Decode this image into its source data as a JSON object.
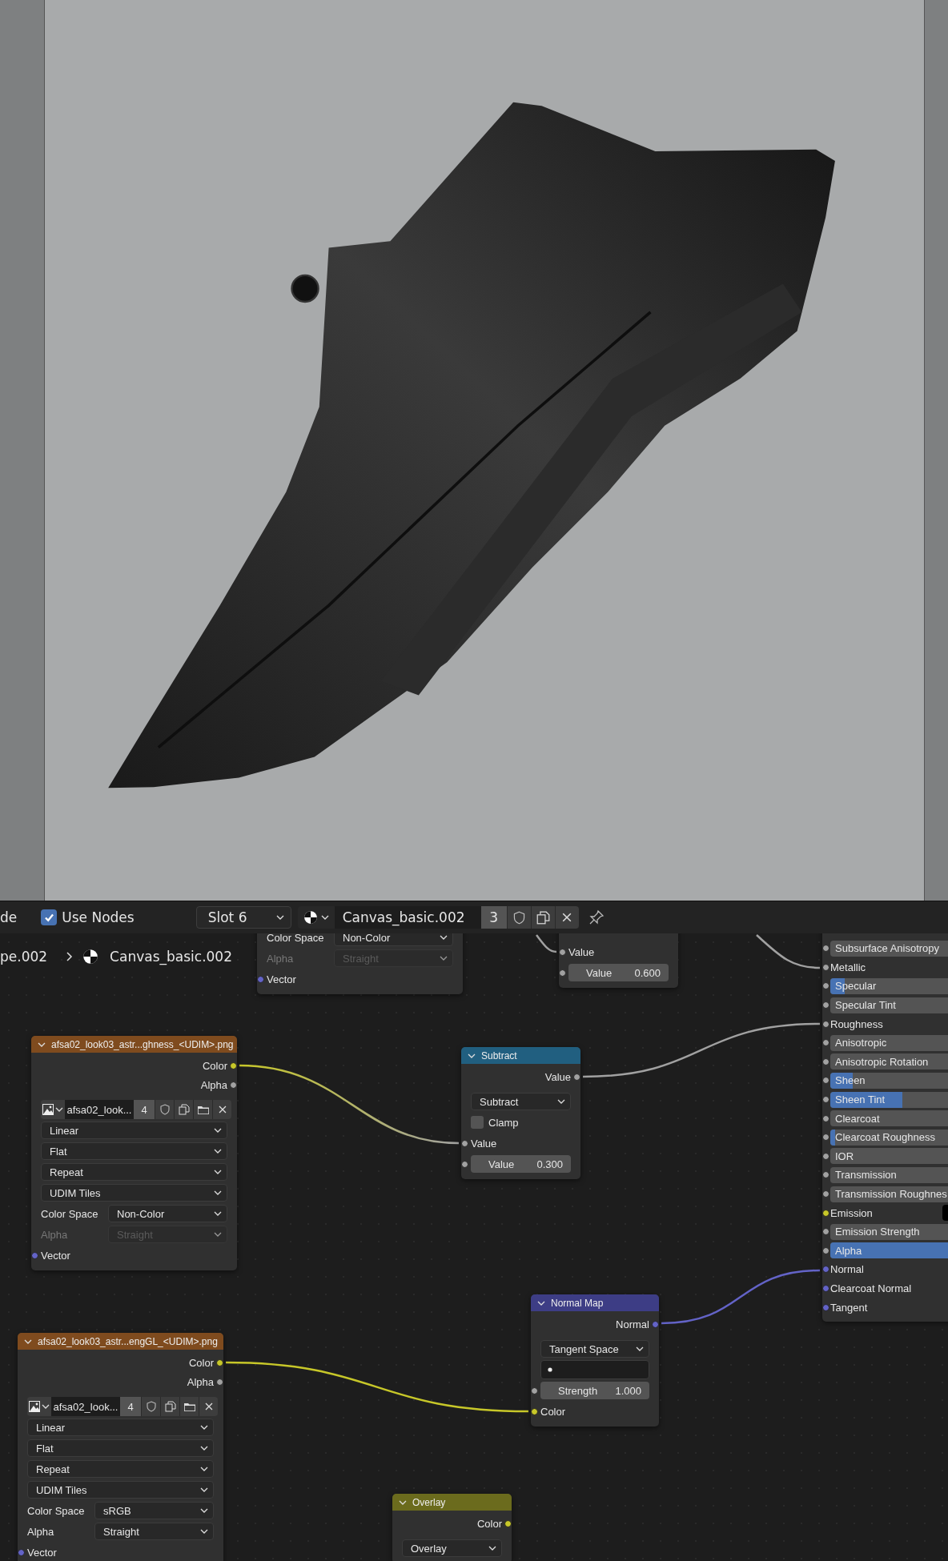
{
  "header": {
    "mode_label": "de",
    "use_nodes": {
      "label": "Use Nodes",
      "checked": true
    },
    "slot": "Slot 6",
    "material": {
      "name": "Canvas_basic.002",
      "users": "3"
    }
  },
  "breadcrumb": [
    "pe.002",
    "Canvas_basic.002"
  ],
  "nodes": [
    {
      "rows": [
        {
          "kind": "prop_dropdown",
          "label": "Color Space",
          "value": "Non-Color",
          "disabled": false
        },
        {
          "kind": "prop_dropdown",
          "label": "Alpha",
          "value": "Straight",
          "disabled": true
        },
        {
          "kind": "input",
          "label": "Vector",
          "socket": {
            "color": "#6363c7"
          }
        }
      ]
    },
    {
      "rows": [
        {
          "kind": "input",
          "label": "Value",
          "socket": {
            "color": "#a1a1a1"
          }
        },
        {
          "kind": "number",
          "label": "Value",
          "value": "0.600",
          "socket": {
            "color": "#a1a1a1"
          }
        }
      ]
    },
    {
      "rows": [
        {
          "kind": "slider",
          "label": "Subsurface Anisotropy",
          "level": 0,
          "socket": {
            "color": "#a1a1a1"
          }
        },
        {
          "kind": "input",
          "label": "Metallic",
          "socket": {
            "color": "#a1a1a1"
          }
        },
        {
          "kind": "slider",
          "label": "Specular",
          "level": 0.09,
          "socket": {
            "color": "#a1a1a1"
          }
        },
        {
          "kind": "slider",
          "label": "Specular Tint",
          "level": 0,
          "socket": {
            "color": "#a1a1a1"
          }
        },
        {
          "kind": "input",
          "label": "Roughness",
          "socket": {
            "color": "#a1a1a1"
          }
        },
        {
          "kind": "slider",
          "label": "Anisotropic",
          "level": 0,
          "socket": {
            "color": "#a1a1a1"
          }
        },
        {
          "kind": "slider",
          "label": "Anisotropic Rotation",
          "level": 0,
          "socket": {
            "color": "#a1a1a1"
          }
        },
        {
          "kind": "slider",
          "label": "Sheen",
          "level": 0.14,
          "socket": {
            "color": "#a1a1a1"
          }
        },
        {
          "kind": "slider",
          "label": "Sheen Tint",
          "level": 0.45,
          "socket": {
            "color": "#a1a1a1"
          }
        },
        {
          "kind": "slider",
          "label": "Clearcoat",
          "level": 0,
          "socket": {
            "color": "#a1a1a1"
          }
        },
        {
          "kind": "slider",
          "label": "Clearcoat Roughness",
          "level": 0.03,
          "socket": {
            "color": "#a1a1a1"
          }
        },
        {
          "kind": "slider",
          "label": "IOR",
          "level": 0,
          "socket": {
            "color": "#a1a1a1"
          }
        },
        {
          "kind": "slider",
          "label": "Transmission",
          "level": 0,
          "socket": {
            "color": "#a1a1a1"
          }
        },
        {
          "kind": "slider",
          "label": "Transmission Roughnes",
          "level": 0,
          "socket": {
            "color": "#a1a1a1"
          }
        },
        {
          "kind": "color_input",
          "label": "Emission",
          "color": "#000000",
          "socket": {
            "color": "#c7c729"
          }
        },
        {
          "kind": "slider",
          "label": "Emission Strength",
          "level": 0,
          "socket": {
            "color": "#a1a1a1"
          }
        },
        {
          "kind": "slider",
          "label": "Alpha",
          "level": 1,
          "socket": {
            "color": "#a1a1a1"
          }
        },
        {
          "kind": "input",
          "label": "Normal",
          "socket": {
            "color": "#6363c7"
          }
        },
        {
          "kind": "input",
          "label": "Clearcoat Normal",
          "socket": {
            "color": "#6363c7"
          }
        },
        {
          "kind": "input",
          "label": "Tangent",
          "socket": {
            "color": "#6363c7"
          }
        }
      ]
    },
    {
      "kind": "image_texture",
      "title": "afsa02_look03_astr...ghness_<UDIM>.png",
      "rows": [
        {
          "kind": "output",
          "label": "Color",
          "socket": {
            "color": "#c7c729"
          }
        },
        {
          "kind": "output",
          "label": "Alpha",
          "socket": {
            "color": "#a1a1a1"
          }
        },
        {
          "kind": "image",
          "name": "afsa02_look...",
          "users": "4"
        },
        {
          "kind": "dropdown",
          "value": "Linear",
          "disabled": false
        },
        {
          "kind": "dropdown",
          "value": "Flat",
          "disabled": false
        },
        {
          "kind": "dropdown",
          "value": "Repeat",
          "disabled": false
        },
        {
          "kind": "dropdown",
          "value": "UDIM Tiles",
          "disabled": false
        },
        {
          "kind": "prop_dropdown",
          "label": "Color Space",
          "value": "Non-Color",
          "disabled": false
        },
        {
          "kind": "prop_dropdown",
          "label": "Alpha",
          "value": "Straight",
          "disabled": true
        },
        {
          "kind": "input",
          "label": "Vector",
          "socket": {
            "color": "#6363c7"
          }
        }
      ]
    },
    {
      "kind": "math",
      "title": "Subtract",
      "rows": [
        {
          "kind": "output",
          "label": "Value",
          "socket": {
            "color": "#a1a1a1"
          }
        },
        {
          "kind": "dropdown",
          "value": "Subtract",
          "disabled": false
        },
        {
          "kind": "checkbox",
          "label": "Clamp",
          "checked": false
        },
        {
          "kind": "input",
          "label": "Value",
          "socket": {
            "color": "#a1a1a1"
          }
        },
        {
          "kind": "number",
          "label": "Value",
          "value": "0.300",
          "socket": {
            "color": "#a1a1a1"
          }
        }
      ]
    },
    {
      "kind": "normal_map",
      "title": "Normal Map",
      "rows": [
        {
          "kind": "output",
          "label": "Normal",
          "socket": {
            "color": "#6363c7"
          }
        },
        {
          "kind": "dropdown",
          "value": "Tangent Space",
          "disabled": false
        },
        {
          "kind": "uv_field"
        },
        {
          "kind": "number",
          "label": "Strength",
          "value": "1.000",
          "socket": {
            "color": "#a1a1a1"
          }
        },
        {
          "kind": "input",
          "label": "Color",
          "socket": {
            "color": "#c7c729"
          }
        }
      ]
    },
    {
      "kind": "image_texture",
      "title": "afsa02_look03_astr...engGL_<UDIM>.png",
      "rows": [
        {
          "kind": "output",
          "label": "Color",
          "socket": {
            "color": "#c7c729"
          }
        },
        {
          "kind": "output",
          "label": "Alpha",
          "socket": {
            "color": "#a1a1a1"
          }
        },
        {
          "kind": "image",
          "name": "afsa02_look...",
          "users": "4"
        },
        {
          "kind": "dropdown",
          "value": "Linear",
          "disabled": false
        },
        {
          "kind": "dropdown",
          "value": "Flat",
          "disabled": false
        },
        {
          "kind": "dropdown",
          "value": "Repeat",
          "disabled": false
        },
        {
          "kind": "dropdown",
          "value": "UDIM Tiles",
          "disabled": false
        },
        {
          "kind": "prop_dropdown",
          "label": "Color Space",
          "value": "sRGB",
          "disabled": false
        },
        {
          "kind": "prop_dropdown",
          "label": "Alpha",
          "value": "Straight",
          "disabled": false
        },
        {
          "kind": "input",
          "label": "Vector",
          "socket": {
            "color": "#6363c7"
          }
        }
      ]
    },
    {
      "kind": "mix",
      "title": "Overlay",
      "rows": [
        {
          "kind": "output",
          "label": "Color",
          "socket": {
            "color": "#c7c729"
          }
        },
        {
          "kind": "dropdown",
          "value": "Overlay",
          "disabled": false
        }
      ]
    }
  ]
}
